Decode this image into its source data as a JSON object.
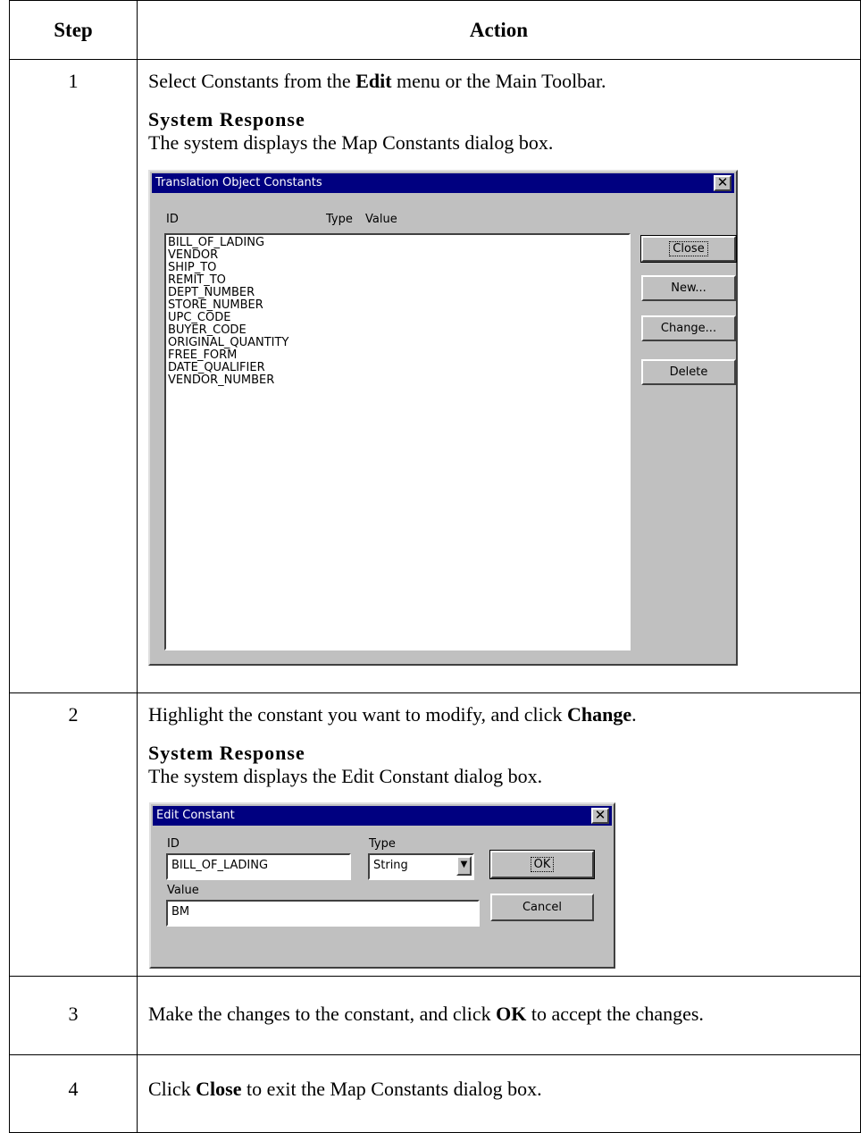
{
  "table": {
    "header_step": "Step",
    "header_action": "Action"
  },
  "steps": [
    {
      "num": "1",
      "pre": "Select Constants from the ",
      "bold": "Edit",
      "post": " menu or the Main Toolbar.",
      "response_head": "System Response",
      "response_text": "The system displays the Map Constants dialog box."
    },
    {
      "num": "2",
      "pre": "Highlight the constant you want to modify, and click ",
      "bold": "Change",
      "post": ".",
      "response_head": "System Response",
      "response_text": "The system displays the Edit Constant dialog box."
    },
    {
      "num": "3",
      "pre": "Make the changes to the constant, and click ",
      "bold": "OK",
      "post": " to accept the changes."
    },
    {
      "num": "4",
      "pre": "Click ",
      "bold": "Close",
      "post": " to exit the Map Constants dialog box."
    }
  ],
  "constants_dialog": {
    "title": "Translation Object Constants",
    "col_id": "ID",
    "col_type": "Type",
    "col_value": "Value",
    "items": [
      "BILL_OF_LADING",
      "VENDOR",
      "SHIP_TO",
      "REMIT_TO",
      "DEPT_NUMBER",
      "STORE_NUMBER",
      "UPC_CODE",
      "BUYER_CODE",
      "ORIGINAL_QUANTITY",
      "FREE_FORM",
      "DATE_QUALIFIER",
      "VENDOR_NUMBER"
    ],
    "btn_close": "Close",
    "btn_new": "New...",
    "btn_change": "Change...",
    "btn_delete": "Delete",
    "close_glyph": "✕"
  },
  "edit_dialog": {
    "title": "Edit Constant",
    "id_label": "ID",
    "id_value": "BILL_OF_LADING",
    "type_label": "Type",
    "type_value": "String",
    "value_label": "Value",
    "value_value": "BM",
    "btn_ok": "OK",
    "btn_cancel": "Cancel",
    "close_glyph": "✕",
    "dropdown_glyph": "▼"
  }
}
